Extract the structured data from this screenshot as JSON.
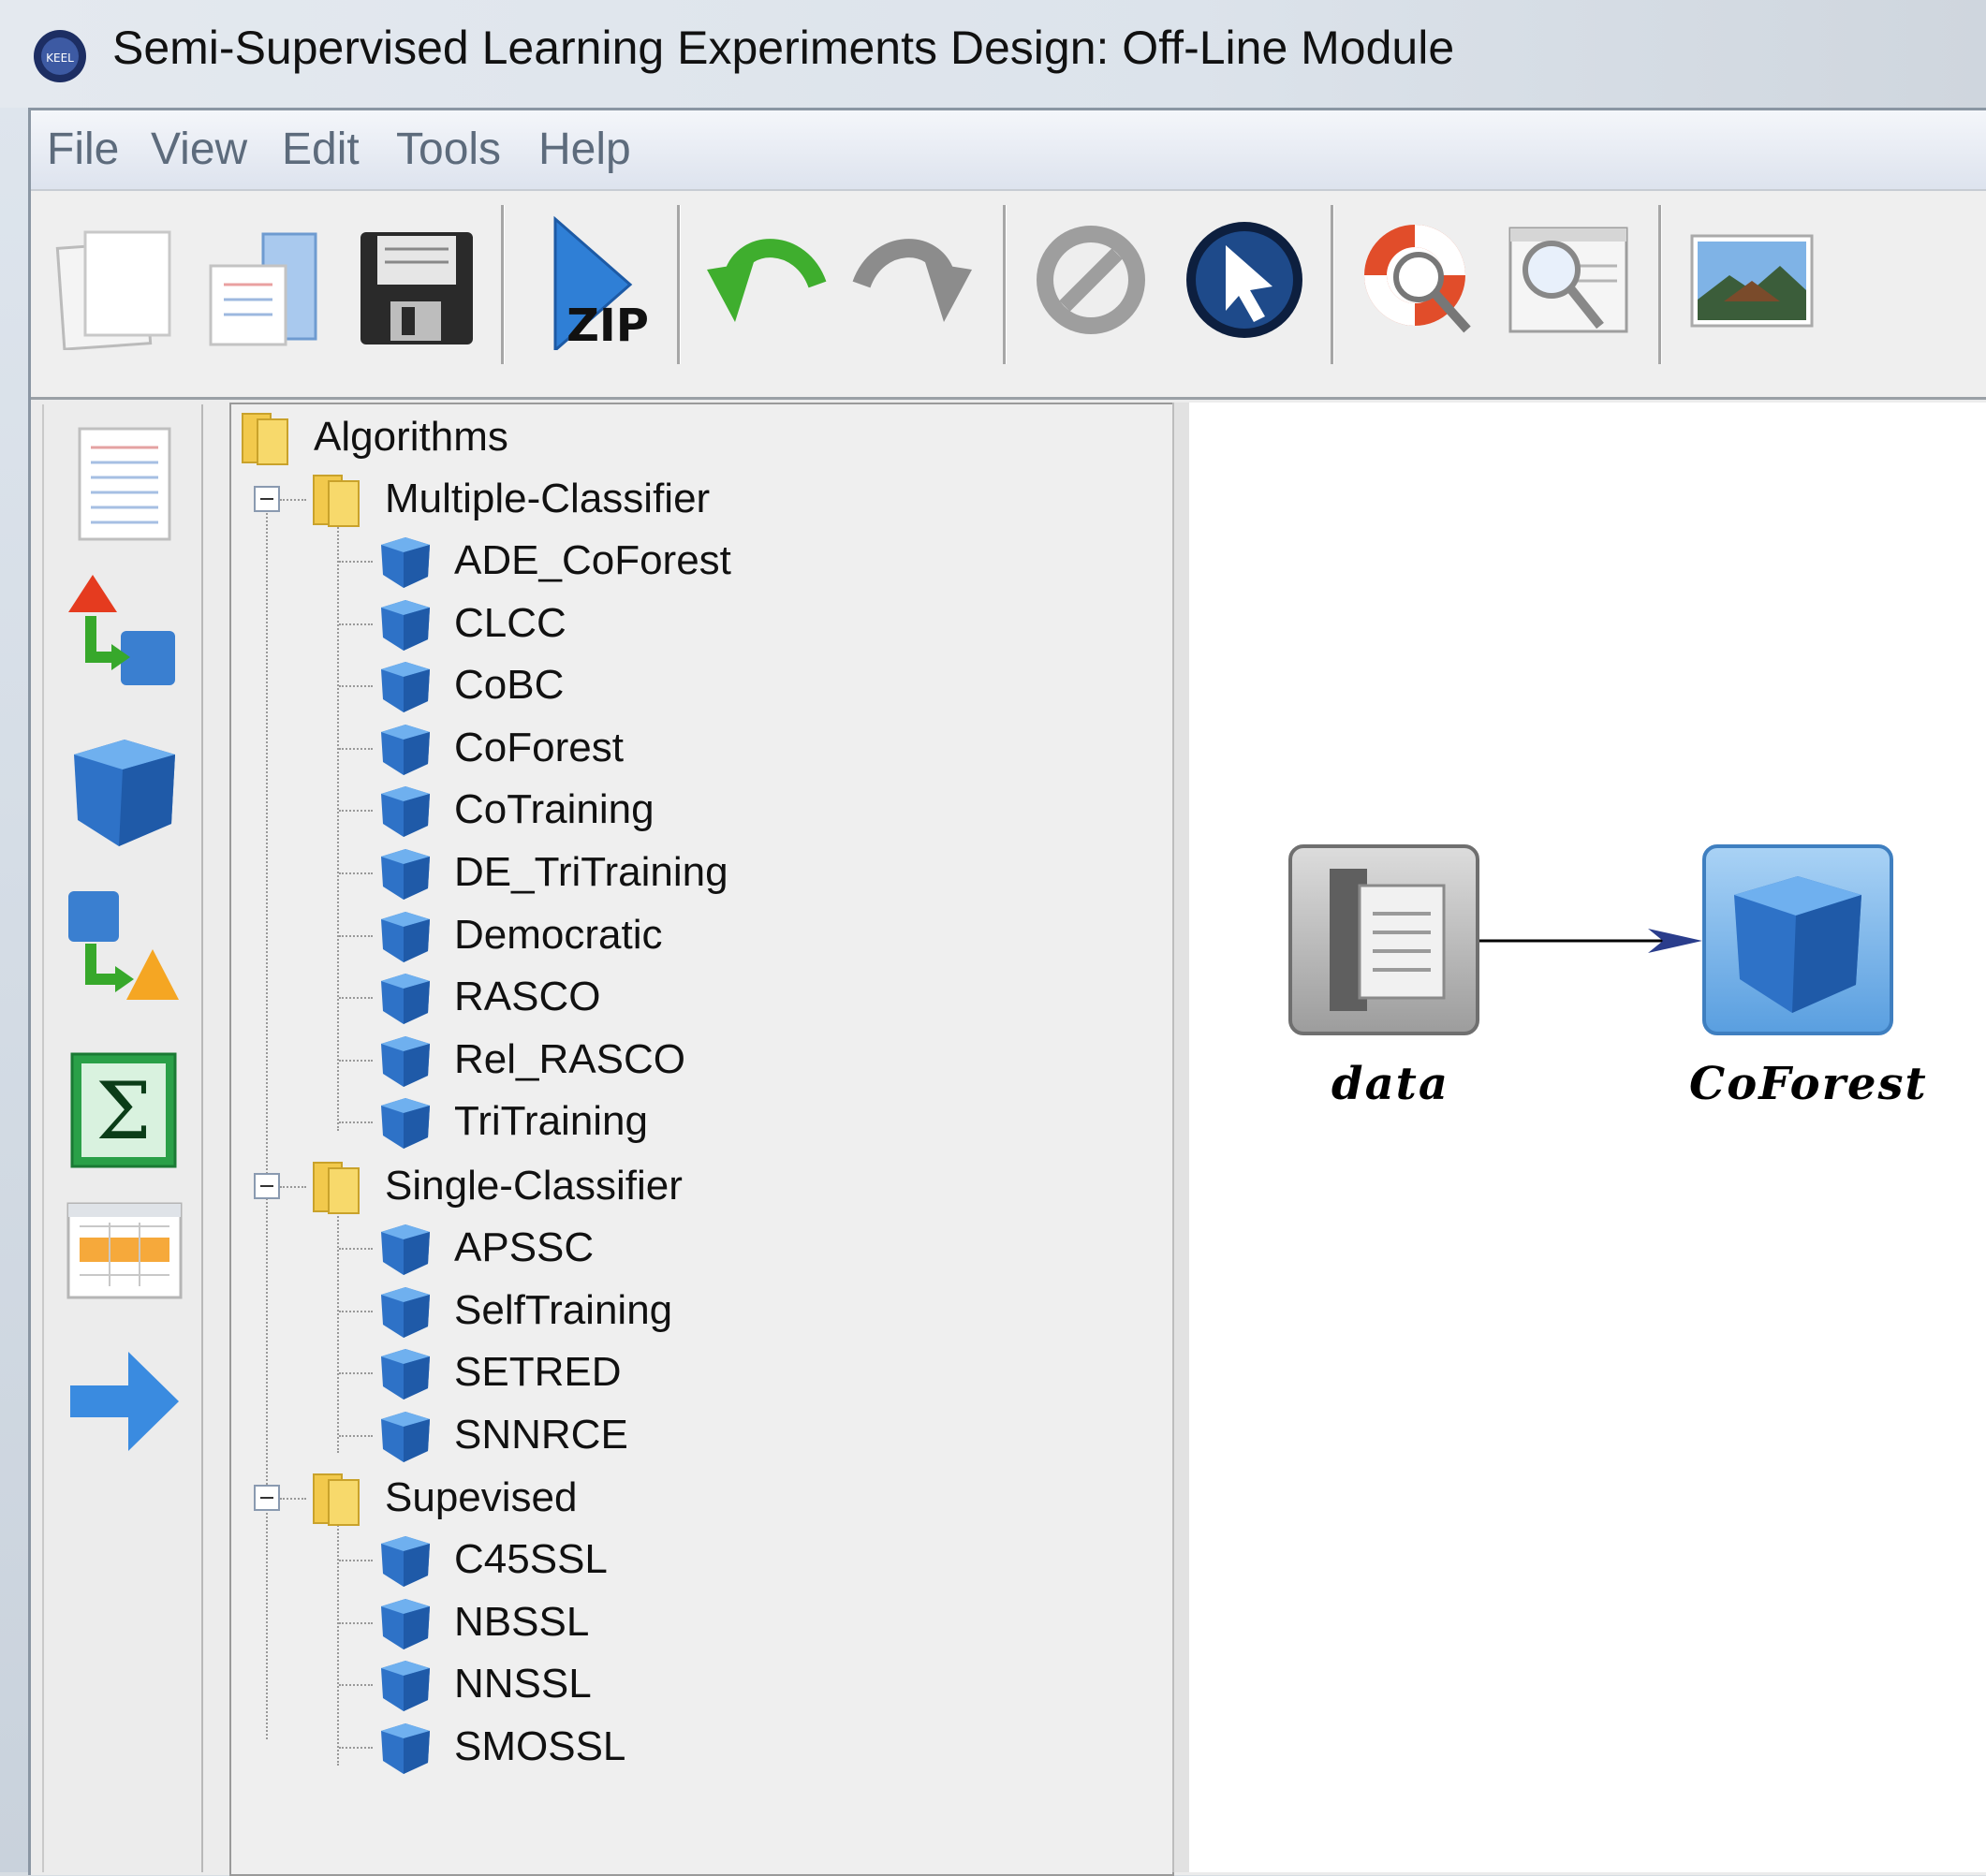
{
  "window": {
    "title": "Semi-Supervised Learning Experiments Design: Off-Line Module"
  },
  "menubar": {
    "items": [
      "File",
      "View",
      "Edit",
      "Tools",
      "Help"
    ]
  },
  "toolbar": {
    "buttons": [
      {
        "icon": "new-document-icon"
      },
      {
        "icon": "open-document-icon"
      },
      {
        "icon": "save-disk-icon"
      },
      {
        "icon": "zip-export-icon",
        "label": "ZIP"
      },
      {
        "icon": "undo-arrow-icon"
      },
      {
        "icon": "redo-arrow-icon"
      },
      {
        "icon": "disabled-icon"
      },
      {
        "icon": "pointer-select-icon"
      },
      {
        "icon": "help-lifebuoy-icon"
      },
      {
        "icon": "zoom-preview-icon"
      },
      {
        "icon": "landscape-image-icon"
      }
    ]
  },
  "palette": {
    "buttons": [
      {
        "icon": "dataset-list-icon"
      },
      {
        "icon": "preprocess-transform-icon"
      },
      {
        "icon": "algorithm-cube-icon"
      },
      {
        "icon": "postprocess-transform-icon"
      },
      {
        "icon": "statistics-sigma-icon"
      },
      {
        "icon": "results-table-icon"
      },
      {
        "icon": "connection-arrow-icon"
      }
    ]
  },
  "tree": {
    "root": "Algorithms",
    "groups": [
      {
        "label": "Multiple-Classifier",
        "items": [
          "ADE_CoForest",
          "CLCC",
          "CoBC",
          "CoForest",
          "CoTraining",
          "DE_TriTraining",
          "Democratic",
          "RASCO",
          "Rel_RASCO",
          "TriTraining"
        ]
      },
      {
        "label": "Single-Classifier",
        "items": [
          "APSSC",
          "SelfTraining",
          "SETRED",
          "SNNRCE"
        ]
      },
      {
        "label": "Supevised",
        "items": [
          "C45SSL",
          "NBSSL",
          "NNSSL",
          "SMOSSL"
        ]
      }
    ]
  },
  "canvas": {
    "nodes": [
      {
        "label": "data",
        "icon": "dataset-document-icon"
      },
      {
        "label": "CoForest",
        "icon": "algorithm-cube-icon"
      }
    ],
    "edges": [
      {
        "from": "data",
        "to": "CoForest"
      }
    ]
  },
  "colors": {
    "cube_blue": "#3a7fd0",
    "folder_yellow": "#f2c94c",
    "menu_text": "#5d6b7c",
    "canvas_bg": "#ffffff"
  }
}
